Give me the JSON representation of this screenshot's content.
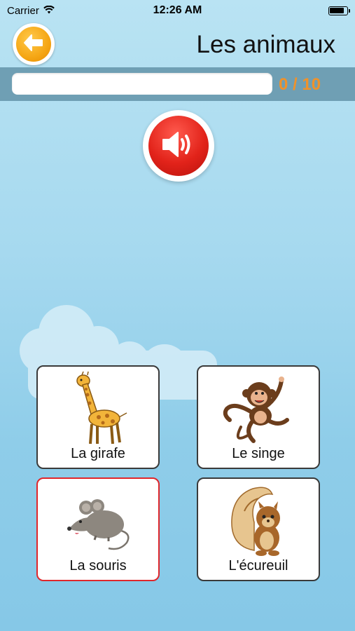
{
  "status_bar": {
    "carrier": "Carrier",
    "time": "12:26 AM",
    "wifi_icon": "wifi-icon",
    "battery_icon": "battery-icon",
    "battery_level": 0.85
  },
  "header": {
    "title": "Les animaux",
    "back_icon": "arrow-left-icon"
  },
  "progress": {
    "count_text": "0 / 10",
    "fraction": 0,
    "accent_color": "#f0922a"
  },
  "sound_button": {
    "icon": "speaker-icon",
    "color": "#e2231a"
  },
  "answers": [
    {
      "label": "La girafe",
      "icon": "giraffe-icon",
      "selected": false
    },
    {
      "label": "Le singe",
      "icon": "monkey-icon",
      "selected": false
    },
    {
      "label": "La souris",
      "icon": "mouse-icon",
      "selected": true
    },
    {
      "label": "L'écureuil",
      "icon": "squirrel-icon",
      "selected": false
    }
  ],
  "colors": {
    "selected_border": "#e0262b",
    "back_button": "#f5a614"
  }
}
